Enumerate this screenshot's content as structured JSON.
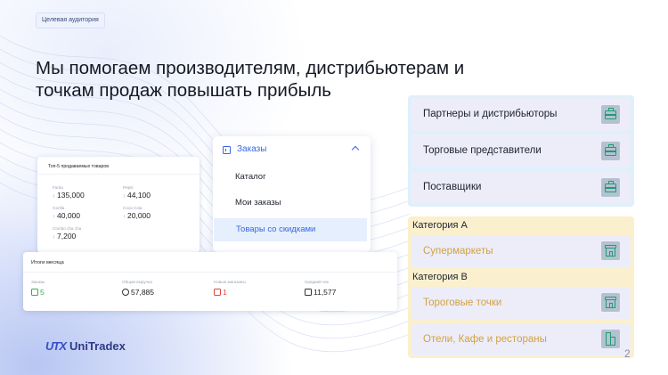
{
  "tag": "Целевая аудитория",
  "headline": {
    "line1": "Мы помогаем производителям, дистрибьютерам и",
    "line2": "точкам продаж повышать прибыль"
  },
  "top5": {
    "title": "Топ-5 продаваемых товаров",
    "items": [
      {
        "name": "Fanta",
        "value": "135,000"
      },
      {
        "name": "Pepsi",
        "value": "44,100"
      },
      {
        "name": "Gorilla",
        "value": "40,000"
      },
      {
        "name": "Coca Cola",
        "value": "20,000"
      },
      {
        "name": "Combo cha cha",
        "value": "7,200"
      }
    ]
  },
  "menu": {
    "header": "Заказы",
    "items": [
      "Каталог",
      "Мои заказы",
      "Товары со скидками"
    ],
    "active_index": 2
  },
  "month": {
    "title": "Итоги месяца",
    "metrics": [
      {
        "name": "Заказы",
        "value": "5",
        "color": "#2fb24e"
      },
      {
        "name": "Общая выручка",
        "value": "57,885",
        "color": "#222222"
      },
      {
        "name": "Новые магазины",
        "value": "1",
        "color": "#e0453a"
      },
      {
        "name": "Средний чек",
        "value": "11,577",
        "color": "#222222"
      }
    ]
  },
  "logo": {
    "mark": "UTX",
    "text": "UniTradex"
  },
  "audience_top": [
    {
      "label": "Партнеры и дистрибьюторы",
      "icon": "briefcase-icon"
    },
    {
      "label": "Торговые представители",
      "icon": "briefcase-icon"
    },
    {
      "label": "Поставщики",
      "icon": "briefcase-icon"
    }
  ],
  "category_a": {
    "title": "Категория А",
    "items": [
      {
        "label": "Супермаркеты",
        "icon": "store-icon"
      }
    ]
  },
  "category_b": {
    "title": "Категория В",
    "items": [
      {
        "label": "Тороговые точки",
        "icon": "store-icon"
      },
      {
        "label": "Отели, Кафе и рестораны",
        "icon": "building-icon"
      }
    ]
  },
  "page_number": "2",
  "colors": {
    "accent": "#3867e0",
    "gold": "#d1a243",
    "icon_green": "#1f9b72"
  }
}
